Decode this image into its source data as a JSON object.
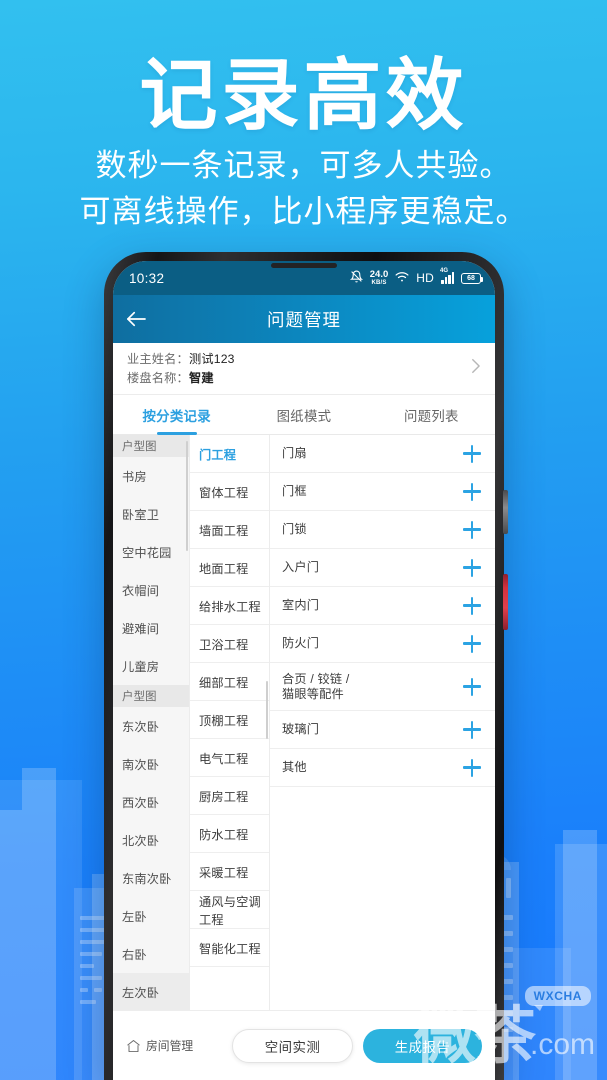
{
  "promo": {
    "title": "记录高效",
    "subtitle_line1": "数秒一条记录，可多人共验。",
    "subtitle_line2": "可离线操作，比小程序更稳定。",
    "bg_top_color": "#32C0EF",
    "bg_bottom_color": "#1878FD"
  },
  "statusbar": {
    "clock": "10:32",
    "net_speed_value": "24.0",
    "net_speed_unit": "KB/S",
    "mute_icon": "bell-mute-icon",
    "wifi_icon": "wifi-icon",
    "hd_label": "HD",
    "network_generation": "4G",
    "signal_icon": "signal-bars-icon",
    "battery_level": "68",
    "bg_color": "#0B5E84"
  },
  "appbar": {
    "back_icon": "back-arrow-icon",
    "title": "问题管理",
    "gradient_from": "#0F6EA0",
    "gradient_to": "#07A1DC"
  },
  "owner": {
    "name_label": "业主姓名：",
    "name_value": "测试123",
    "project_label": "楼盘名称：",
    "project_value": "智建",
    "chevron_icon": "chevron-right-icon"
  },
  "tabs": {
    "accent_color": "#2CA0E0",
    "items": [
      {
        "label": "按分类记录",
        "active": true
      },
      {
        "label": "图纸模式",
        "active": false
      },
      {
        "label": "问题列表",
        "active": false
      }
    ]
  },
  "left_column": {
    "items": [
      {
        "label": "户型图",
        "type": "group"
      },
      {
        "label": "书房",
        "type": "item"
      },
      {
        "label": "卧室卫",
        "type": "item"
      },
      {
        "label": "空中花园",
        "type": "item"
      },
      {
        "label": "衣帽间",
        "type": "item"
      },
      {
        "label": "避难间",
        "type": "item"
      },
      {
        "label": "儿童房",
        "type": "item"
      },
      {
        "label": "户型图",
        "type": "group"
      },
      {
        "label": "东次卧",
        "type": "item"
      },
      {
        "label": "南次卧",
        "type": "item"
      },
      {
        "label": "西次卧",
        "type": "item"
      },
      {
        "label": "北次卧",
        "type": "item"
      },
      {
        "label": "东南次卧",
        "type": "item"
      },
      {
        "label": "左卧",
        "type": "item"
      },
      {
        "label": "右卧",
        "type": "item"
      },
      {
        "label": "左次卧",
        "type": "item",
        "selected": true
      }
    ]
  },
  "mid_column": {
    "items": [
      {
        "label": "门工程",
        "active": true
      },
      {
        "label": "窗体工程",
        "active": false
      },
      {
        "label": "墙面工程",
        "active": false
      },
      {
        "label": "地面工程",
        "active": false
      },
      {
        "label": "给排水工程",
        "active": false
      },
      {
        "label": "卫浴工程",
        "active": false
      },
      {
        "label": "细部工程",
        "active": false
      },
      {
        "label": "顶棚工程",
        "active": false
      },
      {
        "label": "电气工程",
        "active": false
      },
      {
        "label": "厨房工程",
        "active": false
      },
      {
        "label": "防水工程",
        "active": false
      },
      {
        "label": "采暖工程",
        "active": false
      },
      {
        "label": "通风与空调工程",
        "active": false
      },
      {
        "label": "智能化工程",
        "active": false
      }
    ]
  },
  "right_column": {
    "add_icon": "plus-icon",
    "add_icon_color": "#2BA3E3",
    "items": [
      {
        "label": "门扇",
        "lines": 1
      },
      {
        "label": "门框",
        "lines": 1
      },
      {
        "label": "门锁",
        "lines": 1
      },
      {
        "label": "入户门",
        "lines": 1
      },
      {
        "label": "室内门",
        "lines": 1
      },
      {
        "label": "防火门",
        "lines": 1
      },
      {
        "label": "合页 / 铰链 /\n猫眼等配件",
        "lines": 2
      },
      {
        "label": "玻璃门",
        "lines": 1
      },
      {
        "label": "其他",
        "lines": 1
      }
    ]
  },
  "bottombar": {
    "room_mgmt_icon": "home-icon",
    "room_mgmt_label": "房间管理",
    "measure_label": "空间实测",
    "report_label": "生成报告",
    "report_color": "#2CB3DE"
  },
  "watermark": {
    "chars": "微茶",
    "domain": ".com",
    "badge": "WXCHA"
  }
}
